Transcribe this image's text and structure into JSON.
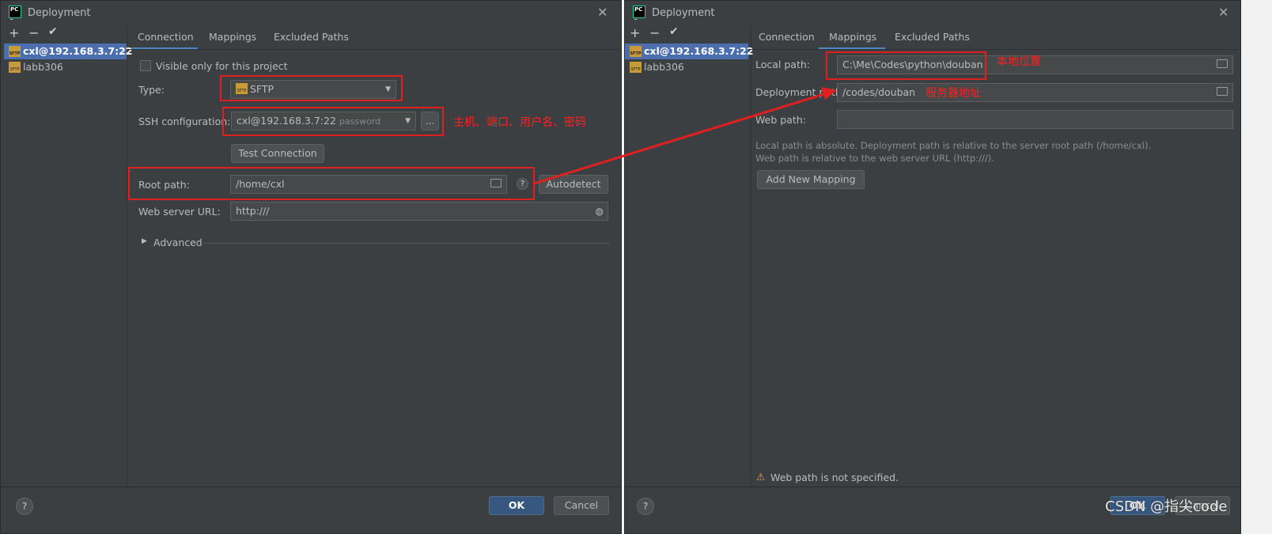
{
  "left": {
    "title": "Deployment",
    "toolbar": {
      "add": "+",
      "remove": "−",
      "check": "✔"
    },
    "servers": [
      {
        "label": "cxl@192.168.3.7:22",
        "selected": true
      },
      {
        "label": "labb306",
        "selected": false
      }
    ],
    "tabs": [
      {
        "label": "Connection",
        "active": true
      },
      {
        "label": "Mappings",
        "active": false
      },
      {
        "label": "Excluded Paths",
        "active": false
      }
    ],
    "visible_only": "Visible only for this project",
    "type_label": "Type:",
    "type_value": "SFTP",
    "ssh_label": "SSH configuration:",
    "ssh_value": "cxl@192.168.3.7:22",
    "ssh_hint": "password",
    "ssh_more": "...",
    "test_connection": "Test Connection",
    "root_label": "Root path:",
    "root_value": "/home/cxl",
    "autodetect": "Autodetect",
    "web_label": "Web server URL:",
    "web_value": "http:///",
    "advanced": "Advanced",
    "ok": "OK",
    "cancel": "Cancel",
    "annotation": "主机、端口、用户名、密码"
  },
  "right": {
    "title": "Deployment",
    "servers": [
      {
        "label": "cxl@192.168.3.7:22",
        "selected": true
      },
      {
        "label": "labb306",
        "selected": false
      }
    ],
    "tabs": [
      {
        "label": "Connection",
        "active": false
      },
      {
        "label": "Mappings",
        "active": true
      },
      {
        "label": "Excluded Paths",
        "active": false
      }
    ],
    "local_label": "Local path:",
    "local_value": "C:\\Me\\Codes\\python\\douban",
    "deploy_label": "Deployment path:",
    "deploy_value": "/codes/douban",
    "web_label": "Web path:",
    "web_value": "",
    "hint1": "Local path is absolute. Deployment path is relative to the server root path (/home/cxl).",
    "hint2": "Web path is relative to the web server URL (http:///).",
    "add_mapping": "Add New Mapping",
    "warning": "Web path is not specified.",
    "annotation_local": "本地位置",
    "annotation_server": "服务器地址",
    "ok": "OK",
    "cancel": "Cancel"
  },
  "watermark": "CSDN @指尖code",
  "colors": {
    "bg": "#3c3f41",
    "selection": "#4b6eaf",
    "annotation": "#e02020"
  }
}
